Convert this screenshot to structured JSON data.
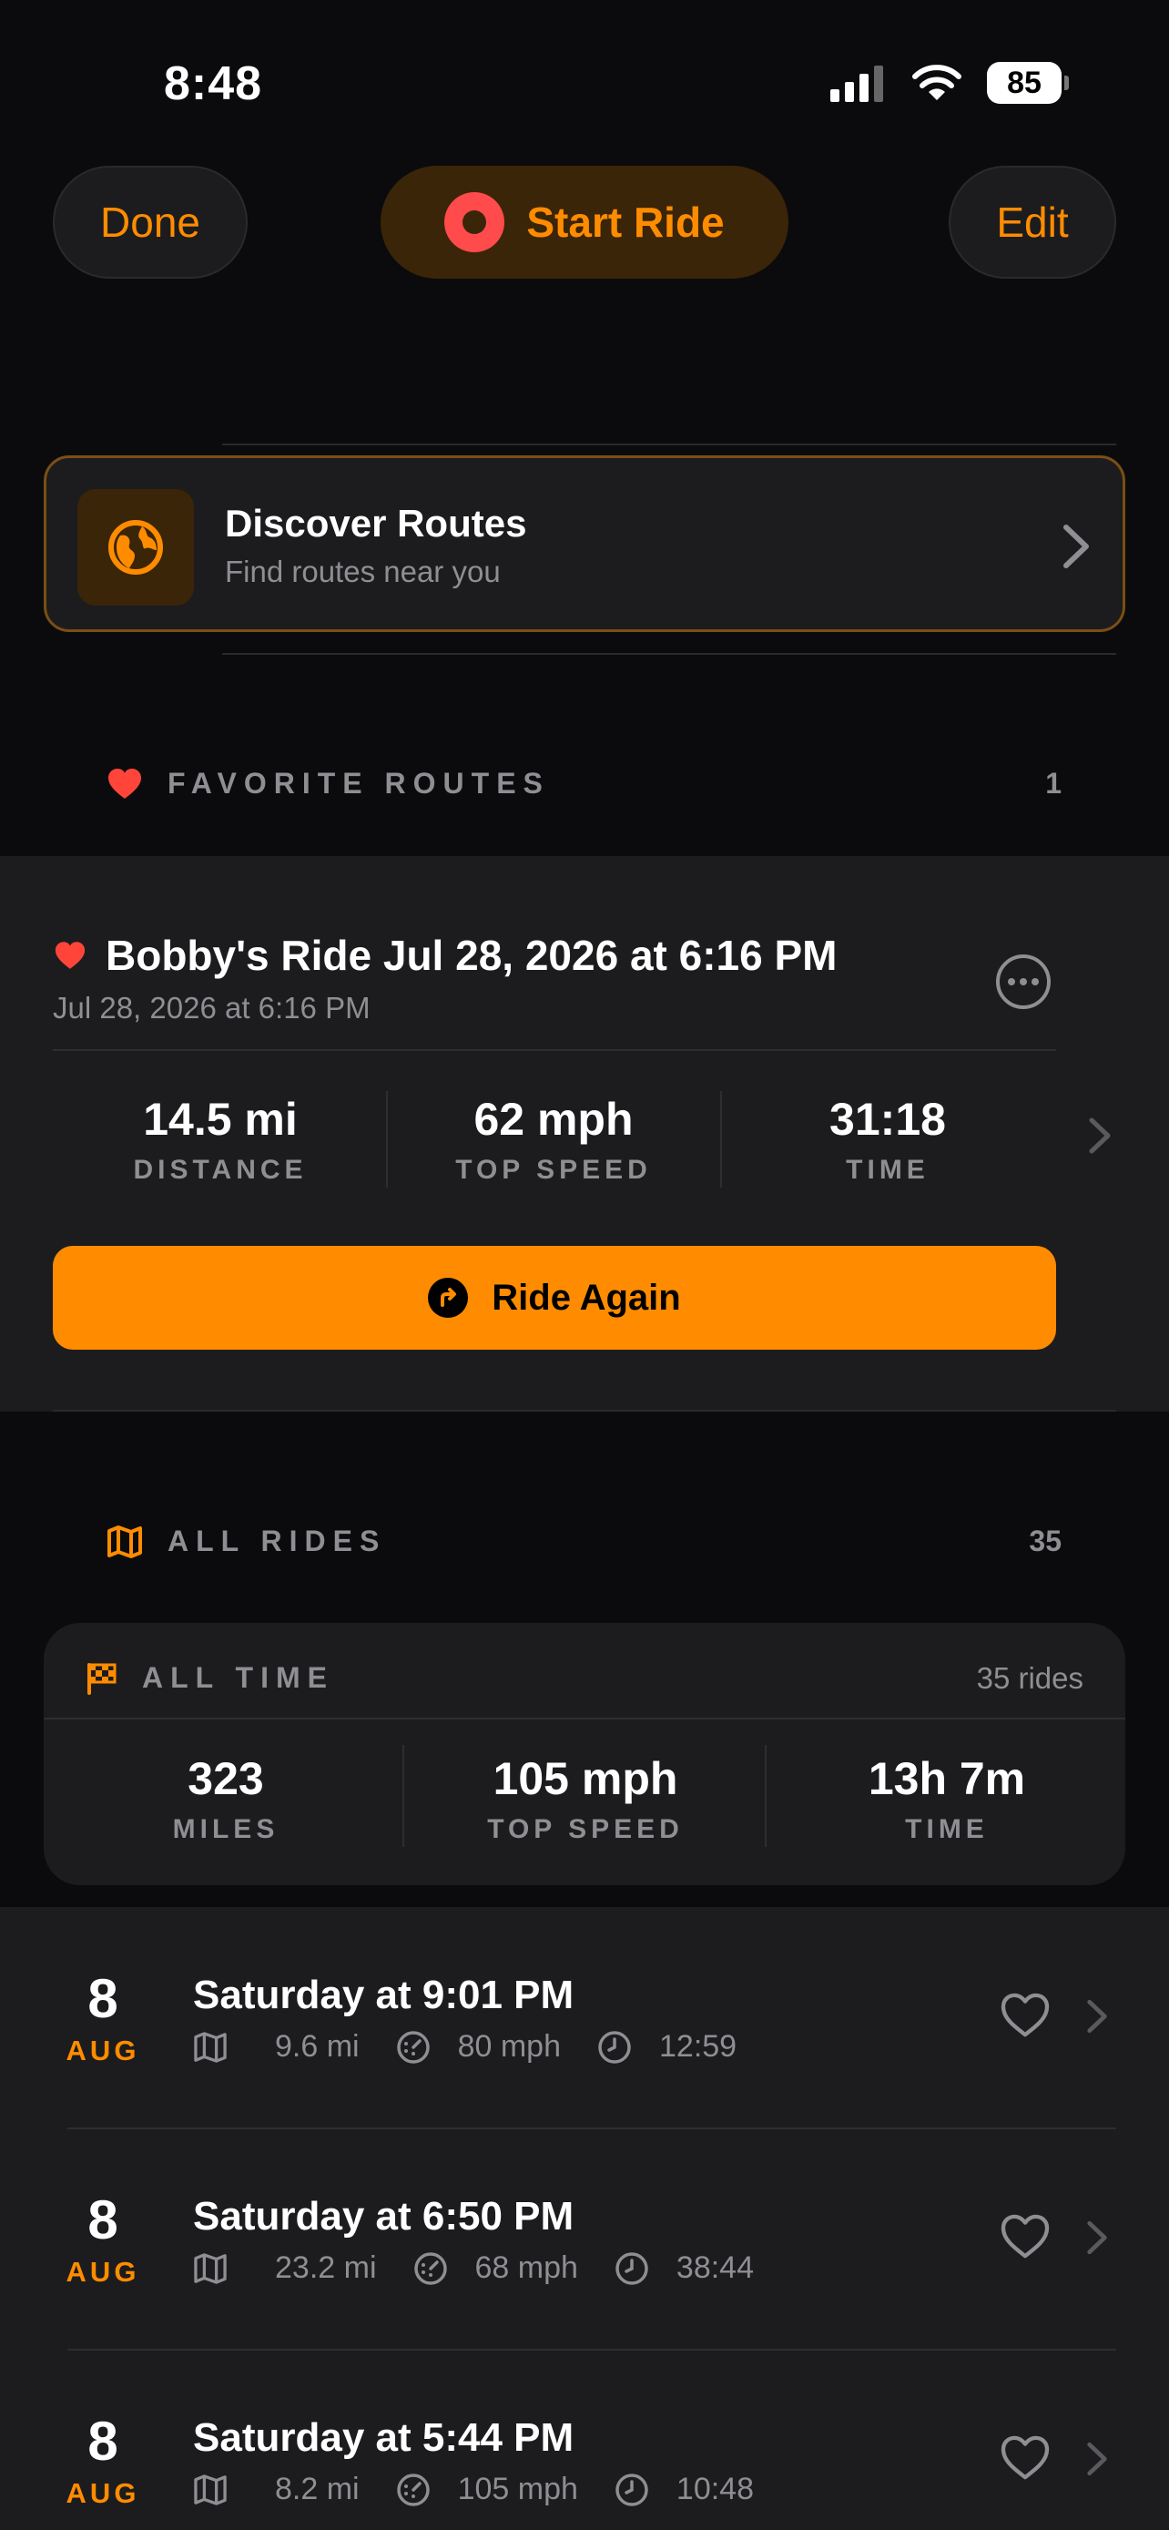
{
  "status_bar": {
    "time": "8:48",
    "battery": "85"
  },
  "nav": {
    "done_label": "Done",
    "start_label": "Start Ride",
    "edit_label": "Edit"
  },
  "discover": {
    "title": "Discover Routes",
    "subtitle": "Find routes near you"
  },
  "favorites": {
    "header": "FAVORITE ROUTES",
    "count": "1",
    "route": {
      "title": "Bobby's Ride Jul 28, 2026 at 6:16 PM",
      "subtitle": "Jul 28, 2026 at 6:16 PM",
      "stats": [
        {
          "value": "14.5 mi",
          "label": "DISTANCE"
        },
        {
          "value": "62 mph",
          "label": "TOP SPEED"
        },
        {
          "value": "31:18",
          "label": "TIME"
        }
      ],
      "ride_again_label": "Ride Again"
    }
  },
  "all_rides": {
    "header": "ALL RIDES",
    "count": "35",
    "all_time": {
      "header": "ALL TIME",
      "count_label": "35 rides",
      "stats": [
        {
          "value": "323",
          "label": "MILES"
        },
        {
          "value": "105 mph",
          "label": "TOP SPEED"
        },
        {
          "value": "13h 7m",
          "label": "TIME"
        }
      ]
    },
    "rides": [
      {
        "day": "8",
        "month": "AUG",
        "title": "Saturday at 9:01 PM",
        "distance": "9.6 mi",
        "speed": "80 mph",
        "time": "12:59"
      },
      {
        "day": "8",
        "month": "AUG",
        "title": "Saturday at 6:50 PM",
        "distance": "23.2 mi",
        "speed": "68 mph",
        "time": "38:44"
      },
      {
        "day": "8",
        "month": "AUG",
        "title": "Saturday at 5:44 PM",
        "distance": "8.2 mi",
        "speed": "105 mph",
        "time": "10:48"
      }
    ]
  },
  "colors": {
    "accent": "#ff8c00",
    "heart": "#ff453a",
    "background": "#0b0b0d",
    "card": "#1c1c1e",
    "muted": "#8e8e93"
  },
  "icons": [
    "signal-icon",
    "wifi-icon",
    "battery-icon",
    "record-icon",
    "globe-icon",
    "chevron-right-icon",
    "heart-icon",
    "more-icon",
    "ride-again-icon",
    "map-icon",
    "flag-icon",
    "speedometer-icon",
    "clock-icon"
  ]
}
